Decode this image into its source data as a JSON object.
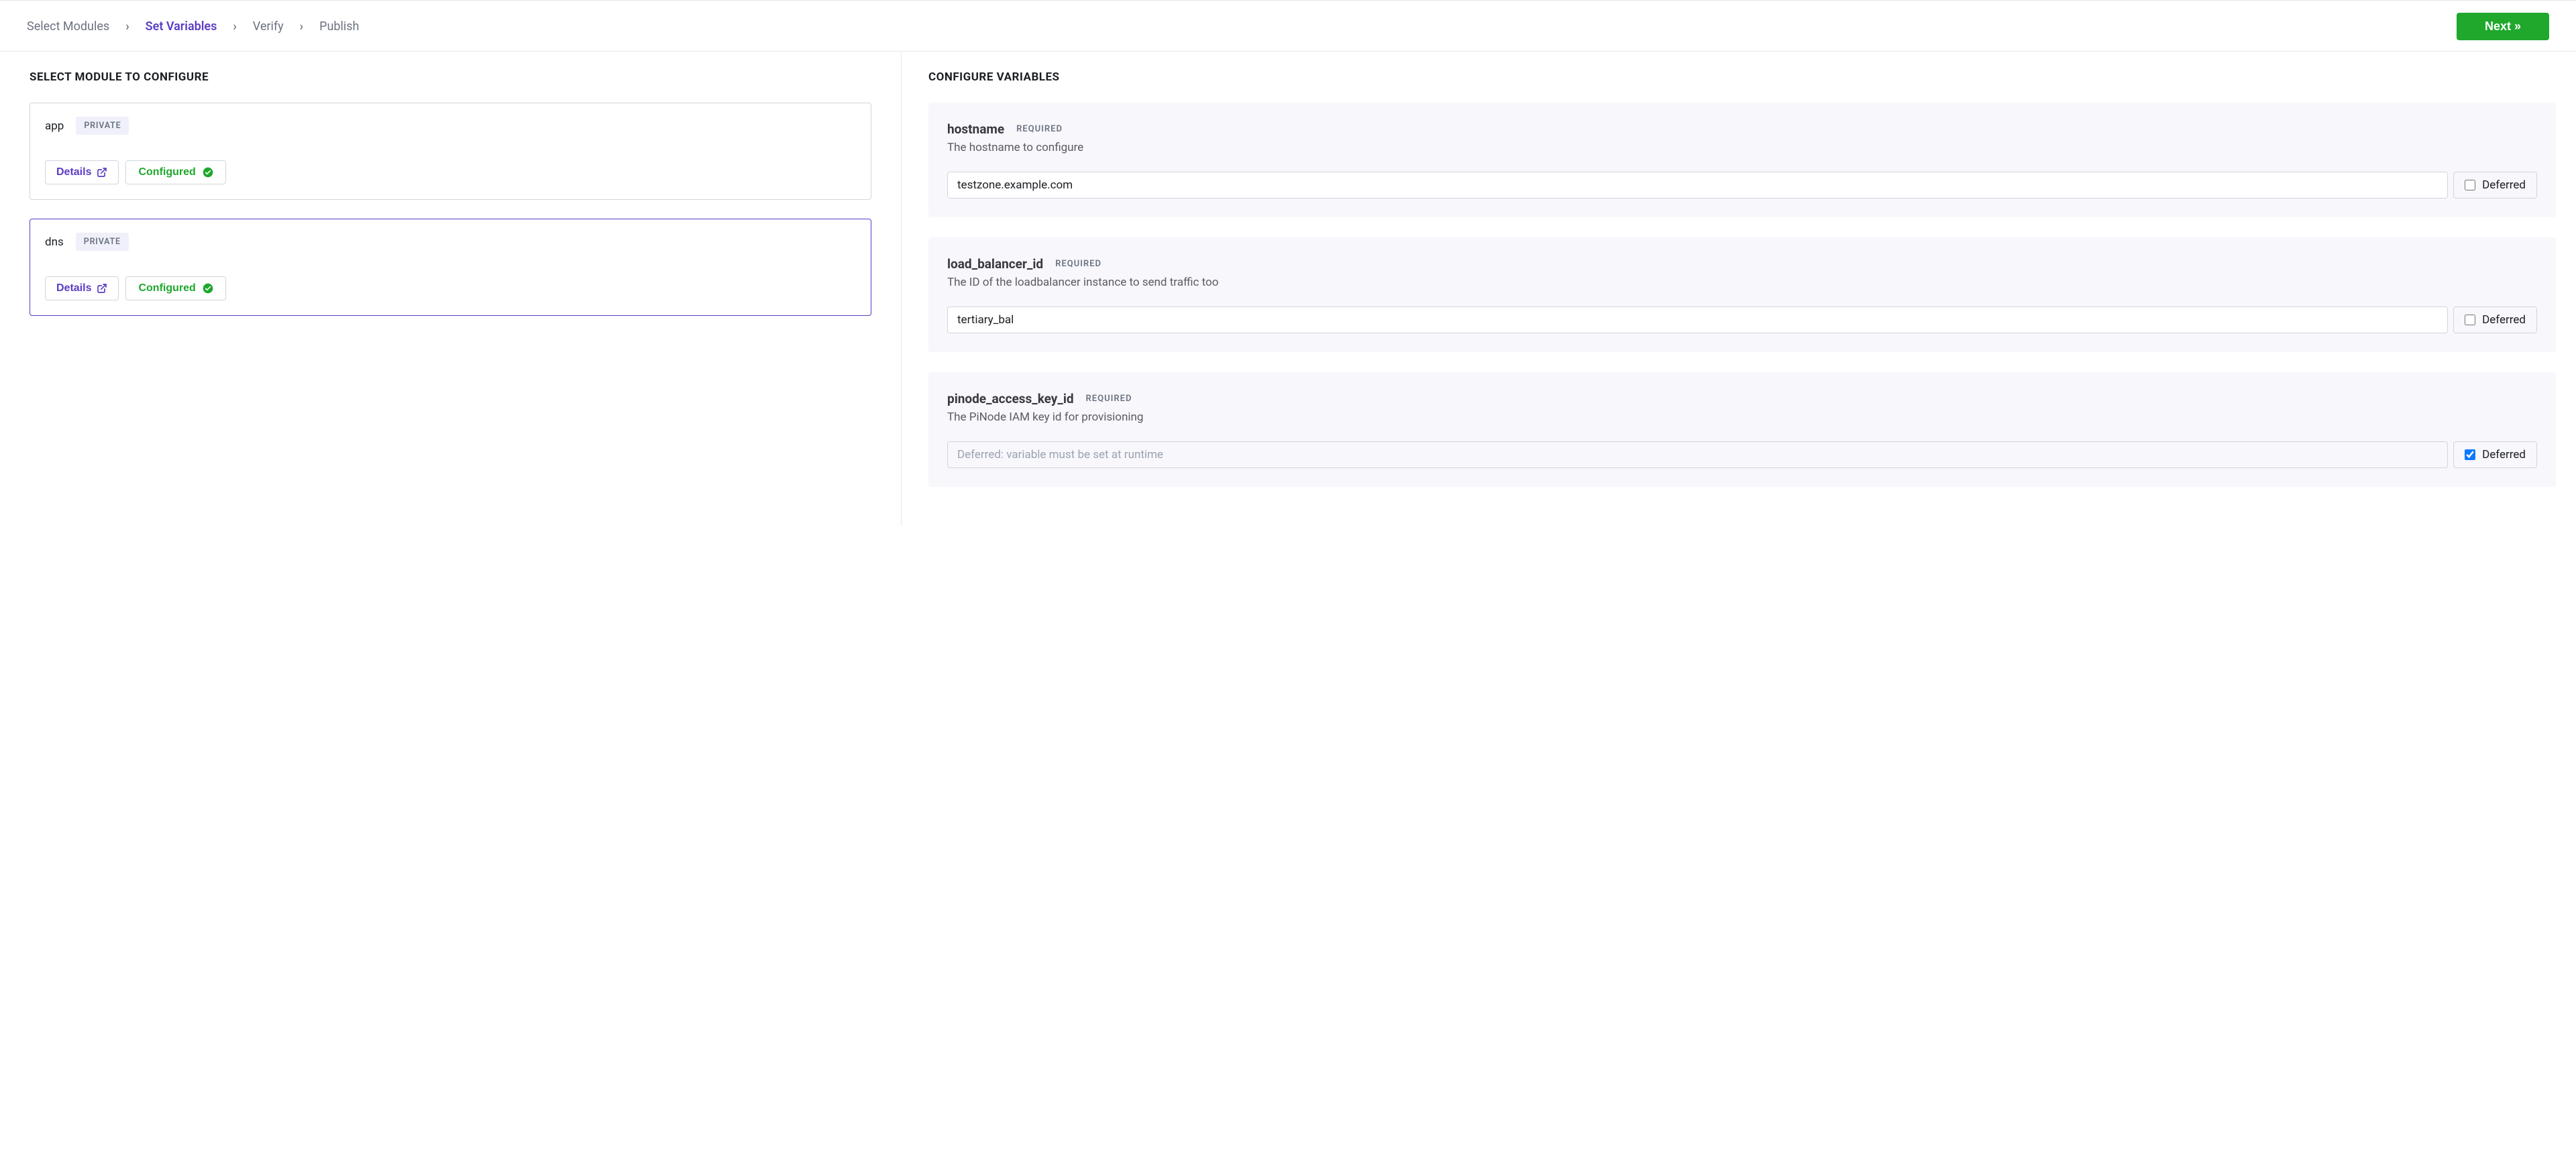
{
  "breadcrumbs": {
    "items": [
      {
        "label": "Select Modules",
        "active": false
      },
      {
        "label": "Set Variables",
        "active": true
      },
      {
        "label": "Verify",
        "active": false
      },
      {
        "label": "Publish",
        "active": false
      }
    ],
    "next_label": "Next »"
  },
  "left": {
    "title": "SELECT MODULE TO CONFIGURE",
    "modules": [
      {
        "name": "app",
        "visibility": "PRIVATE",
        "details_label": "Details",
        "status_label": "Configured",
        "selected": false
      },
      {
        "name": "dns",
        "visibility": "PRIVATE",
        "details_label": "Details",
        "status_label": "Configured",
        "selected": true
      }
    ]
  },
  "right": {
    "title": "CONFIGURE VARIABLES",
    "deferred_checkbox_label": "Deferred",
    "required_label": "REQUIRED",
    "deferred_placeholder": "Deferred: variable must be set at runtime",
    "variables": [
      {
        "name": "hostname",
        "description": "The hostname to configure",
        "value": "testzone.example.com",
        "deferred": false
      },
      {
        "name": "load_balancer_id",
        "description": "The ID of the loadbalancer instance to send traffic too",
        "value": "tertiary_bal",
        "deferred": false
      },
      {
        "name": "pinode_access_key_id",
        "description": "The PiNode IAM key id for provisioning",
        "value": "",
        "deferred": true
      }
    ]
  }
}
